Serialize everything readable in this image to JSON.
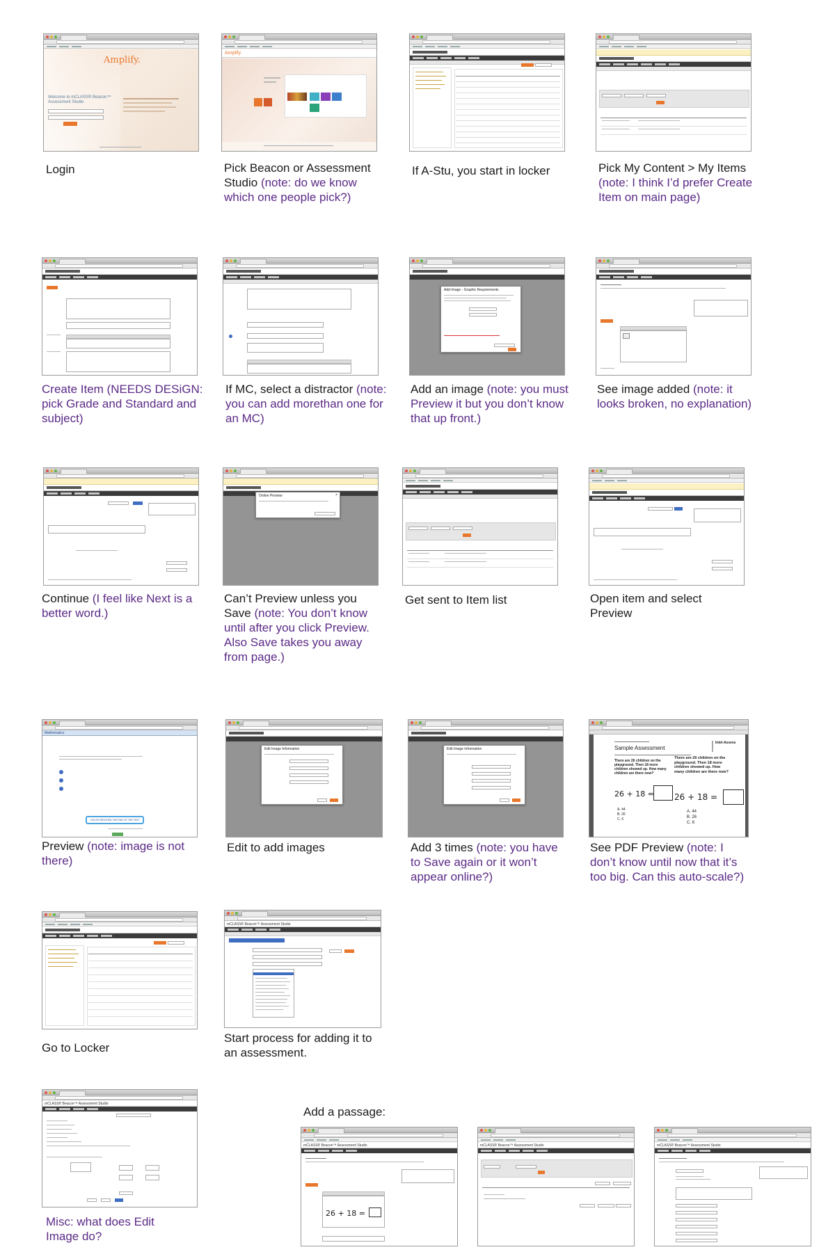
{
  "steps": [
    {
      "label": "Login",
      "note": ""
    },
    {
      "label": "Pick Beacon or Assessment Studio ",
      "note": "(note: do we know  which one people pick?)"
    },
    {
      "label": "If A-Stu, you start in locker",
      "note": ""
    },
    {
      "label": "Pick My Content > My Items ",
      "note": "(note: I think I’d prefer Create Item on main page)"
    },
    {
      "label": "Create Item  (NEEDS DESiGN: pick Grade and Standard and subject)",
      "note": ""
    },
    {
      "label": "If MC, select a distractor ",
      "note": "(note: you can add morethan one for an MC)"
    },
    {
      "label": "Add an image ",
      "note": "(note: you must Preview it but you don’t know that up front.)"
    },
    {
      "label": "See image added ",
      "note": "(note: it looks broken, no explanation)"
    },
    {
      "label": "Continue ",
      "note": "(I feel like Next is a better word.)"
    },
    {
      "label": "Can’t Preview unless you Save ",
      "note": "(note: You don’t know until after you click Preview. Also Save takes you away from page.)"
    },
    {
      "label": "Get sent to Item list",
      "note": ""
    },
    {
      "label": "Open item and select Preview",
      "note": ""
    },
    {
      "label": "Preview ",
      "note": "(note: image is not there)"
    },
    {
      "label": "Edit to add images",
      "note": ""
    },
    {
      "label": "Add 3 times ",
      "note": "(note: you have to Save again or it won’t appear online?)"
    },
    {
      "label": "See PDF Preview ",
      "note": "(note: I don’t know until now that it’s too big. Can this auto-scale?)"
    },
    {
      "label": "Go to Locker",
      "note": ""
    },
    {
      "label": "Start process for adding it to an assessment.",
      "note": ""
    },
    {
      "label": "Misc: what does Edit Image do?",
      "note": ""
    }
  ],
  "add_passage": {
    "title": "Add a passage:"
  },
  "thumb_text": {
    "amplify": "Amplify.",
    "welcome": "Welcome to mCLASS® Beacon™ Assessment Studio",
    "login_btn": "Log In",
    "studio": "mCLASS® Beacon™ Assessment Studio",
    "online_preview": "Online Preview",
    "add_image": "Add Image - Graphic Requirements",
    "edit_image": "Edit Image Information",
    "sample": "Sample Assessment",
    "math": "Mathematics",
    "end_of_test": "YOU’VE REACHED THE END OF THE TEST",
    "eq": "26 + 18 =",
    "choices": [
      "A. 44",
      "B. 26",
      "C. 6"
    ],
    "question": "There are 26 children on the playground. Then 18 more children showed up. How many children are there now?"
  },
  "colors": {
    "note": "#5b2a86",
    "orange": "#e8772c",
    "nav": "#3b3b3b"
  }
}
